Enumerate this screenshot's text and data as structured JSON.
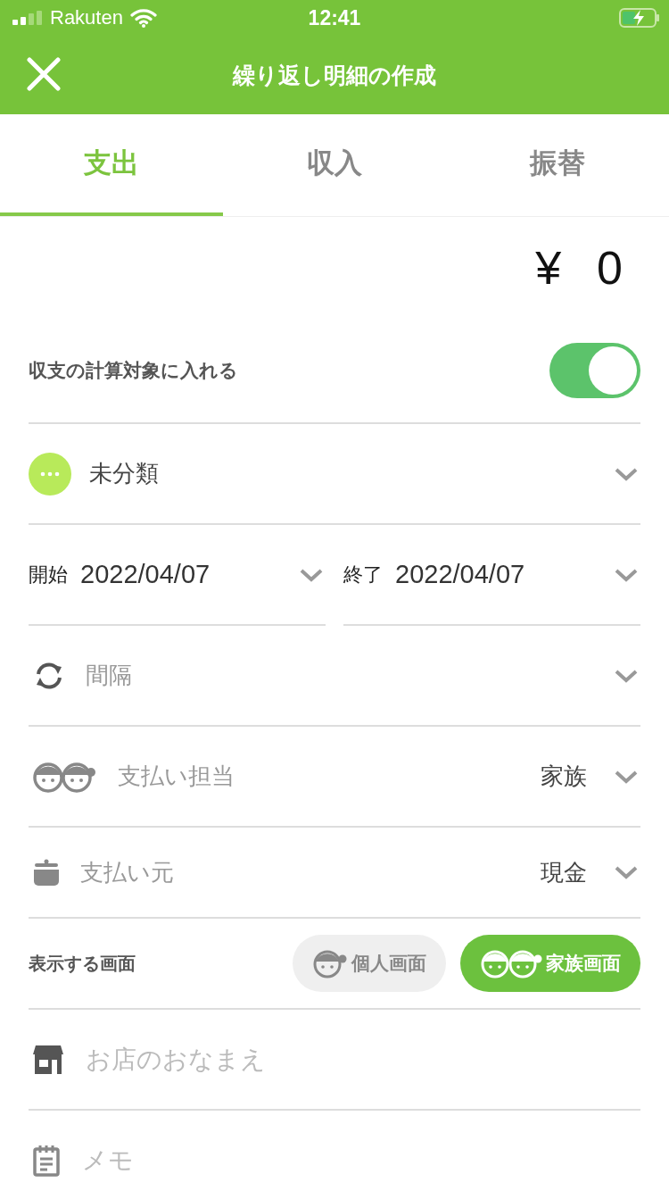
{
  "status_bar": {
    "carrier": "Rakuten",
    "time": "12:41"
  },
  "header": {
    "title": "繰り返し明細の作成"
  },
  "tabs": [
    {
      "label": "支出",
      "selected": true
    },
    {
      "label": "収入",
      "selected": false
    },
    {
      "label": "振替",
      "selected": false
    }
  ],
  "amount": {
    "currency": "¥",
    "value": "0"
  },
  "include_toggle": {
    "label": "収支の計算対象に入れる",
    "on": true
  },
  "category": {
    "value": "未分類"
  },
  "dates": [
    {
      "label": "開始",
      "value": "2022/04/07"
    },
    {
      "label": "終了",
      "value": "2022/04/07"
    }
  ],
  "interval": {
    "label": "間隔"
  },
  "payer": {
    "label": "支払い担当",
    "value": "家族"
  },
  "source": {
    "label": "支払い元",
    "value": "現金"
  },
  "display_screen": {
    "label": "表示する画面",
    "options": [
      {
        "label": "個人画面",
        "kind": "personal",
        "selected": false
      },
      {
        "label": "家族画面",
        "kind": "family",
        "selected": true
      }
    ]
  },
  "store": {
    "placeholder": "お店のおなまえ"
  },
  "memo": {
    "placeholder": "メモ"
  }
}
